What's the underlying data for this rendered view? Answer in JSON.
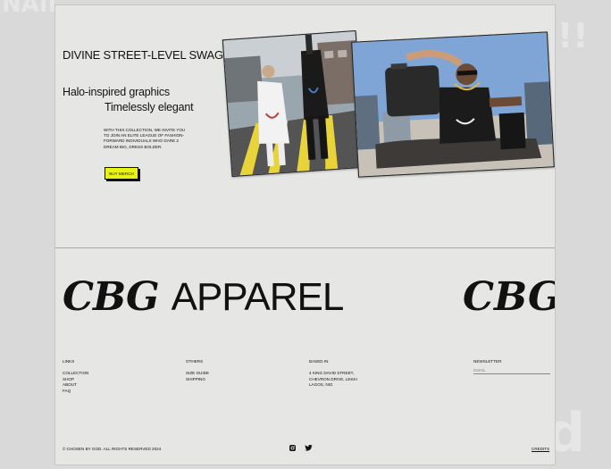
{
  "background_ghost": {
    "top_left": "NAII",
    "top_right": "!!",
    "bottom_right": "d"
  },
  "hero": {
    "headline": "DIVINE STREET-LEVEL SWAGGER",
    "tagline_1": "Halo-inspired graphics",
    "tagline_2": "Timelessly elegant",
    "blurb": "WITH THIS COLLECTION, WE INVITE YOU TO JOIN AN ELITE LEAGUE OF FASHION-FORWARD INDIVIDUALS WHO DARE 2 DREAM BIG, DRESS BOLDER.",
    "cta_label": "BUY MERCH",
    "cta_color": "#e8f214"
  },
  "brand": {
    "logo_mark": "CBG",
    "name": "APPAREL"
  },
  "footer": {
    "links": {
      "heading": "LINKS",
      "items": [
        "COLLECTION",
        "SHOP",
        "ABOUT",
        "FAQ"
      ]
    },
    "others": {
      "heading": "OTHERS",
      "items": [
        "SIZE GUIDE",
        "SHIPPING"
      ]
    },
    "based_in": {
      "heading": "BASED IN",
      "lines": [
        "4 KING DAVID STREET,",
        "CHEVRON DRIVE, LEKKI",
        "LAGOS, NIG"
      ]
    },
    "newsletter": {
      "heading": "NEWSLETTER",
      "placeholder": "EMAIL"
    },
    "copyright": "© CHOSEN BY GOD. ALL RIGHTS RESERVED 2024",
    "social_icons": [
      "instagram-icon",
      "twitter-icon"
    ],
    "credits_label": "CREDITS"
  }
}
